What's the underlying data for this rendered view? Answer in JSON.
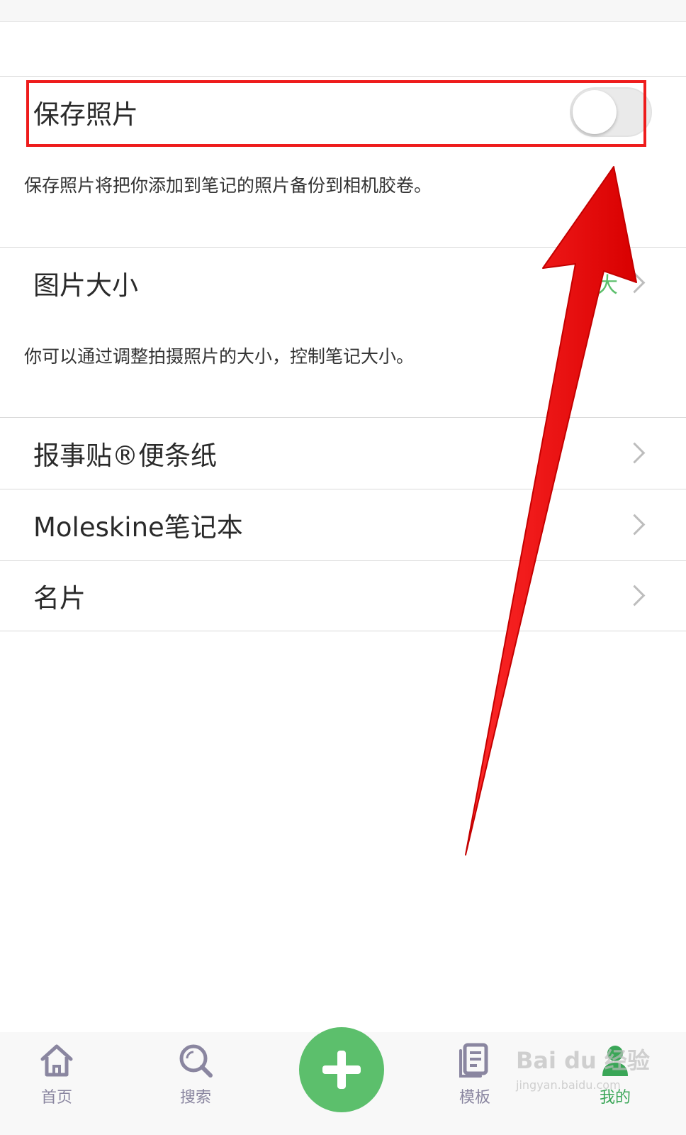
{
  "settings": {
    "save_photos": {
      "label": "保存照片",
      "enabled": false,
      "description": "保存照片将把你添加到笔记的照片备份到相机胶卷。"
    },
    "image_size": {
      "label": "图片大小",
      "value": "大",
      "description": "你可以通过调整拍摄照片的大小，控制笔记大小。"
    },
    "items": [
      {
        "label": "报事贴®便条纸"
      },
      {
        "label": "Moleskine笔记本"
      },
      {
        "label": "名片"
      }
    ]
  },
  "tabbar": {
    "tabs": [
      {
        "label": "首页",
        "icon": "home-icon"
      },
      {
        "label": "搜索",
        "icon": "search-icon"
      },
      {
        "label": "模板",
        "icon": "template-icon"
      },
      {
        "label": "我的",
        "icon": "profile-icon",
        "active": true
      }
    ],
    "add_icon": "plus-icon"
  },
  "watermark": {
    "text": "Bai du 经验",
    "sub": "jingyan.baidu.com"
  },
  "colors": {
    "accent_green": "#5cbf6c",
    "annotation_red": "#ee1c1c",
    "tab_inactive": "#8a86a0"
  }
}
